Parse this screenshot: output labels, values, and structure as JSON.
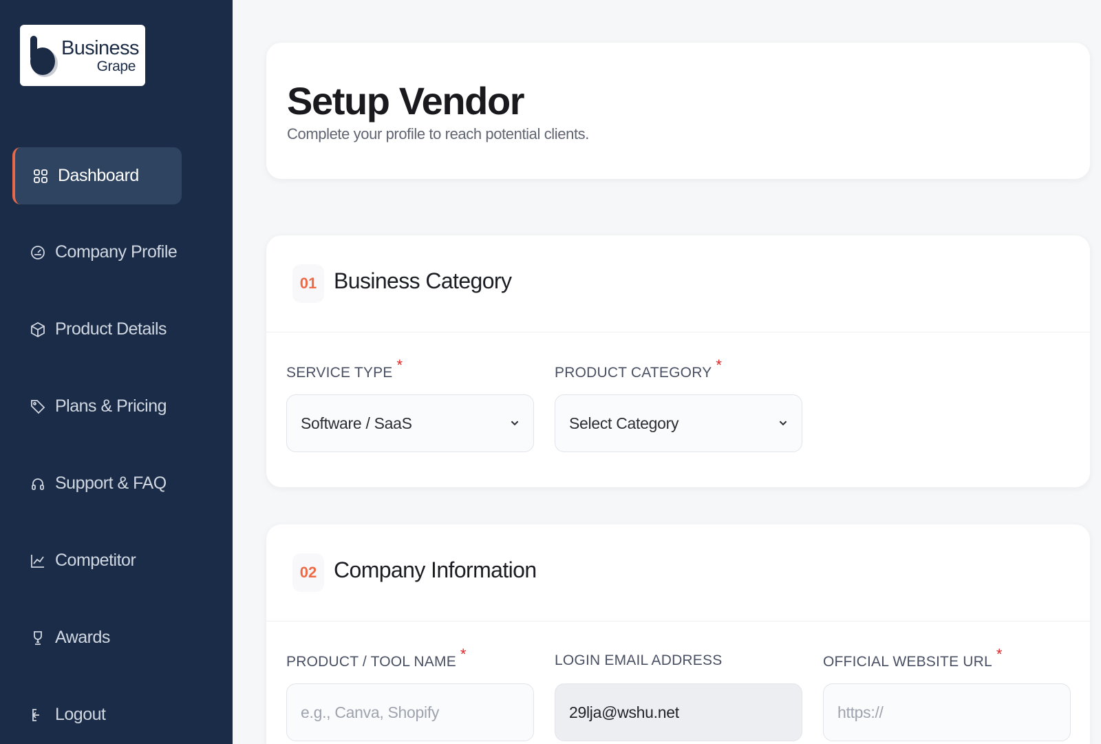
{
  "brand": {
    "name_line1": "Business",
    "name_line2": "Grape"
  },
  "sidebar": {
    "items": [
      {
        "label": "Dashboard",
        "icon": "grid-icon",
        "active": true
      },
      {
        "label": "Company Profile",
        "icon": "gauge-icon",
        "active": false
      },
      {
        "label": "Product Details",
        "icon": "box-icon",
        "active": false
      },
      {
        "label": "Plans & Pricing",
        "icon": "tag-icon",
        "active": false
      },
      {
        "label": "Support & FAQ",
        "icon": "headset-icon",
        "active": false
      },
      {
        "label": "Competitor",
        "icon": "trend-chart-icon",
        "active": false
      },
      {
        "label": "Awards",
        "icon": "trophy-icon",
        "active": false
      },
      {
        "label": "Logout",
        "icon": "logout-icon",
        "active": false
      }
    ]
  },
  "header": {
    "title": "Setup Vendor",
    "subtitle": "Complete your profile to reach potential clients."
  },
  "sections": [
    {
      "number": "01",
      "title": "Business Category",
      "fields": [
        {
          "label": "SERVICE TYPE",
          "required": true,
          "value": "Software / SaaS"
        },
        {
          "label": "PRODUCT CATEGORY",
          "required": true,
          "value": "Select Category"
        }
      ]
    },
    {
      "number": "02",
      "title": "Company Information",
      "fields": [
        {
          "label": "PRODUCT / TOOL NAME",
          "required": true,
          "placeholder": "e.g., Canva, Shopify"
        },
        {
          "label": "LOGIN EMAIL ADDRESS",
          "required": false,
          "value": "29lja@wshu.net"
        },
        {
          "label": "OFFICIAL WEBSITE URL",
          "required": true,
          "placeholder": "https://"
        }
      ]
    }
  ],
  "colors": {
    "sidebar_bg": "#1a2c48",
    "active_item_bg": "#2f4460",
    "accent": "#e8684a",
    "required_star": "#e02424"
  }
}
